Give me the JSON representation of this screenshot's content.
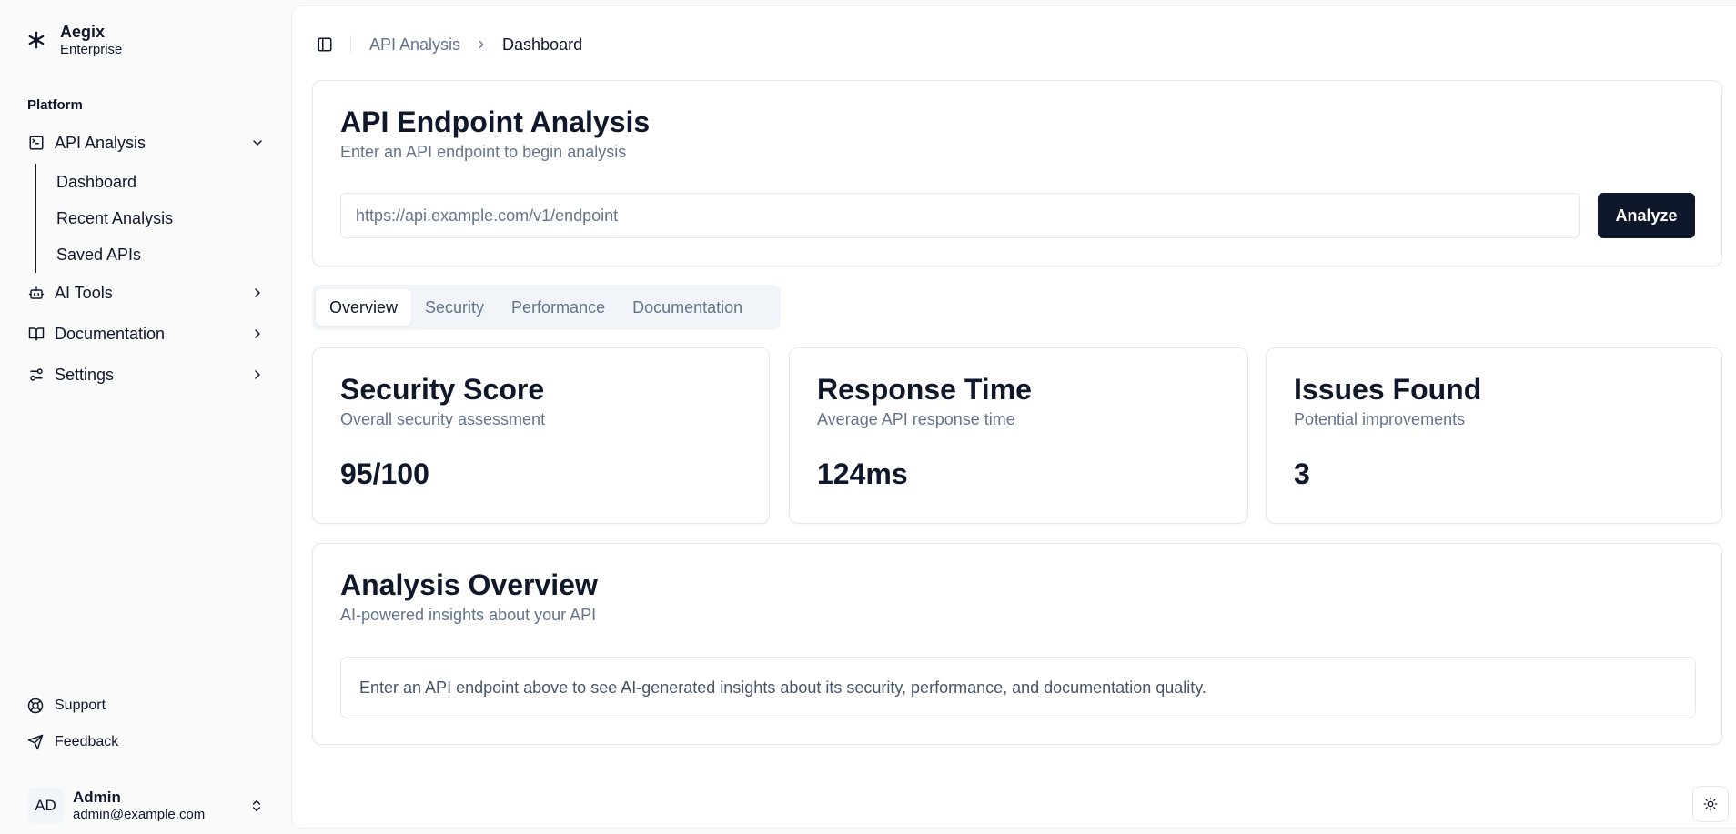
{
  "brand": {
    "name": "Aegix",
    "plan": "Enterprise"
  },
  "sidebar": {
    "group_label": "Platform",
    "items": [
      {
        "label": "API Analysis",
        "icon": "terminal-square-icon",
        "expanded": true,
        "children": [
          {
            "label": "Dashboard"
          },
          {
            "label": "Recent Analysis"
          },
          {
            "label": "Saved APIs"
          }
        ]
      },
      {
        "label": "AI Tools",
        "icon": "bot-icon",
        "expanded": false
      },
      {
        "label": "Documentation",
        "icon": "book-open-icon",
        "expanded": false
      },
      {
        "label": "Settings",
        "icon": "sliders-icon",
        "expanded": false
      }
    ],
    "footer_links": [
      {
        "label": "Support",
        "icon": "life-buoy-icon"
      },
      {
        "label": "Feedback",
        "icon": "send-icon"
      }
    ],
    "user": {
      "initials": "AD",
      "name": "Admin",
      "email": "admin@example.com"
    }
  },
  "breadcrumb": {
    "parent": "API Analysis",
    "current": "Dashboard"
  },
  "endpoint_card": {
    "title": "API Endpoint Analysis",
    "description": "Enter an API endpoint to begin analysis",
    "input_placeholder": "https://api.example.com/v1/endpoint",
    "input_value": "",
    "button_label": "Analyze"
  },
  "tabs": [
    {
      "label": "Overview",
      "active": true
    },
    {
      "label": "Security",
      "active": false
    },
    {
      "label": "Performance",
      "active": false
    },
    {
      "label": "Documentation",
      "active": false
    }
  ],
  "metrics": [
    {
      "title": "Security Score",
      "description": "Overall security assessment",
      "value": "95/100"
    },
    {
      "title": "Response Time",
      "description": "Average API response time",
      "value": "124ms"
    },
    {
      "title": "Issues Found",
      "description": "Potential improvements",
      "value": "3"
    }
  ],
  "overview_card": {
    "title": "Analysis Overview",
    "description": "AI-powered insights about your API",
    "placeholder_text": "Enter an API endpoint above to see AI-generated insights about its security, performance, and documentation quality."
  },
  "colors": {
    "primary": "#0f172a",
    "muted_text": "#64748b",
    "border": "#e5e7eb",
    "tab_bg": "#f1f5f9"
  }
}
